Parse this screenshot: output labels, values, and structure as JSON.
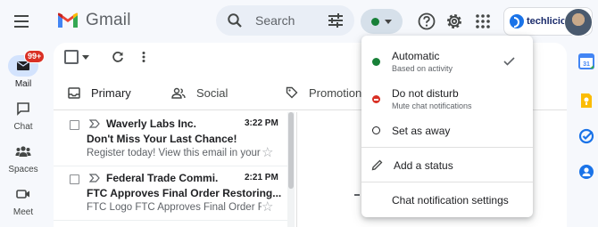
{
  "app": {
    "name": "Gmail"
  },
  "search": {
    "placeholder": "Search"
  },
  "account": {
    "brand": "techlicious"
  },
  "rail": {
    "mail": {
      "label": "Mail",
      "badge": "99+"
    },
    "chat": {
      "label": "Chat"
    },
    "spaces": {
      "label": "Spaces"
    },
    "meet": {
      "label": "Meet"
    }
  },
  "tabs": {
    "primary": "Primary",
    "social": "Social",
    "promotions": "Promotions"
  },
  "emails": [
    {
      "sender": "Waverly Labs Inc.",
      "time": "3:22 PM",
      "subject": "Don't Miss Your Last Chance!",
      "snippet": "Register today! View this email in your ..."
    },
    {
      "sender": "Federal Trade Commi.",
      "time": "2:21 PM",
      "subject": "FTC Approves Final Order Restoring...",
      "snippet": "FTC Logo FTC Approves Final Order R..."
    }
  ],
  "status_menu": {
    "automatic": {
      "label": "Automatic",
      "sub": "Based on activity",
      "selected": true
    },
    "dnd": {
      "label": "Do not disturb",
      "sub": "Mute chat notifications"
    },
    "away": {
      "label": "Set as away"
    },
    "add_status": {
      "label": "Add a status"
    },
    "settings": {
      "label": "Chat notification settings"
    }
  },
  "colors": {
    "active": "#188038",
    "dnd": "#d93025",
    "accent": "#1a73e8",
    "background": "#f6f8fc"
  }
}
